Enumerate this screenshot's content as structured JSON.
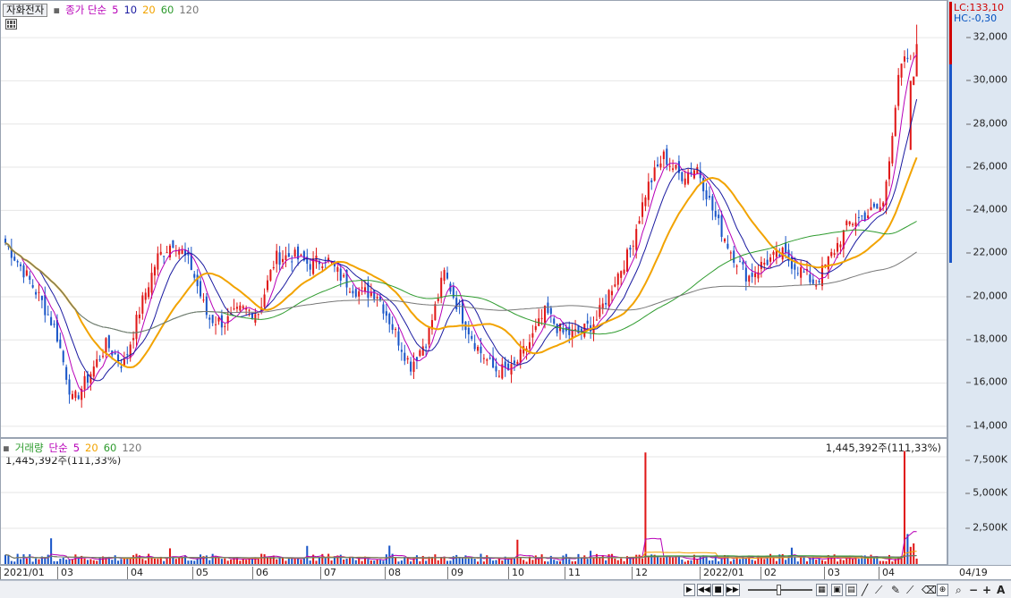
{
  "price_legend": {
    "symbol": "자화전자",
    "ma_label": "종가 단순",
    "periods": [
      "5",
      "10",
      "20",
      "60",
      "120"
    ],
    "colors": [
      "#b800b8",
      "#1a1aa0",
      "#f2a300",
      "#2e9b2e",
      "#777777"
    ]
  },
  "volume_legend": {
    "label": "거래량",
    "ma_label": "단순",
    "periods": [
      "5",
      "20",
      "60",
      "120"
    ],
    "colors": [
      "#b800b8",
      "#f2a300",
      "#2e9b2e",
      "#777777"
    ],
    "current_value": "1,445,392주(111,33%)",
    "current_value_right": "1,445,392주(111,33%)"
  },
  "limits": {
    "lc": "LC:133,10",
    "hc": "HC:-0,30",
    "lc_color": "#d00000",
    "hc_color": "#0050c0"
  },
  "price_axis_labels": [
    "32,000",
    "30,000",
    "28,000",
    "26,000",
    "24,000",
    "22,000",
    "20,000",
    "18,000",
    "16,000",
    "14,000"
  ],
  "volume_axis_labels": [
    "7,500K",
    "5,000K",
    "2,500K"
  ],
  "x_axis_labels": [
    "2021/01",
    "03",
    "04",
    "05",
    "06",
    "07",
    "08",
    "09",
    "10",
    "11",
    "12",
    "2022/01",
    "02",
    "03",
    "04",
    "04/19"
  ],
  "colors": {
    "up": "#e01818",
    "down": "#1a56c8",
    "grid": "#e6e6e6",
    "axis_bg": "#dde7f2"
  },
  "chart_data": [
    {
      "type": "candlestick",
      "title": "자화전자",
      "y_axis_ticks": [
        14000,
        16000,
        18000,
        20000,
        22000,
        24000,
        26000,
        28000,
        30000,
        32000
      ],
      "ylim": [
        13500,
        33700
      ],
      "x_ticks": [
        "2021/01",
        "03",
        "04",
        "05",
        "06",
        "07",
        "08",
        "09",
        "10",
        "11",
        "12",
        "2022/01",
        "02",
        "03",
        "04"
      ],
      "close_path": [
        {
          "d": "2021/01",
          "v": 22500
        },
        {
          "d": "",
          "v": 21300
        },
        {
          "d": "",
          "v": 20000
        },
        {
          "d": "",
          "v": 18400
        },
        {
          "d": "03",
          "v": 15100
        },
        {
          "d": "",
          "v": 16400
        },
        {
          "d": "",
          "v": 17800
        },
        {
          "d": "",
          "v": 16800
        },
        {
          "d": "04",
          "v": 19500
        },
        {
          "d": "",
          "v": 21800
        },
        {
          "d": "",
          "v": 22600
        },
        {
          "d": "",
          "v": 21400
        },
        {
          "d": "05",
          "v": 19000
        },
        {
          "d": "",
          "v": 18800
        },
        {
          "d": "",
          "v": 19400
        },
        {
          "d": "06",
          "v": 19300
        },
        {
          "d": "",
          "v": 21800
        },
        {
          "d": "",
          "v": 21900
        },
        {
          "d": "07",
          "v": 21500
        },
        {
          "d": "",
          "v": 21800
        },
        {
          "d": "",
          "v": 20800
        },
        {
          "d": "08",
          "v": 20200
        },
        {
          "d": "",
          "v": 20200
        },
        {
          "d": "",
          "v": 18500
        },
        {
          "d": "",
          "v": 16800
        },
        {
          "d": "09",
          "v": 18100
        },
        {
          "d": "",
          "v": 21100
        },
        {
          "d": "",
          "v": 19200
        },
        {
          "d": "",
          "v": 17600
        },
        {
          "d": "10",
          "v": 16600
        },
        {
          "d": "",
          "v": 16600
        },
        {
          "d": "",
          "v": 17800
        },
        {
          "d": "11",
          "v": 19300
        },
        {
          "d": "",
          "v": 18300
        },
        {
          "d": "",
          "v": 18300
        },
        {
          "d": "",
          "v": 18900
        },
        {
          "d": "",
          "v": 20600
        },
        {
          "d": "12",
          "v": 22100
        },
        {
          "d": "",
          "v": 25000
        },
        {
          "d": "",
          "v": 26500
        },
        {
          "d": "",
          "v": 25600
        },
        {
          "d": "2022/01",
          "v": 26000
        },
        {
          "d": "",
          "v": 23800
        },
        {
          "d": "",
          "v": 22100
        },
        {
          "d": "02",
          "v": 20900
        },
        {
          "d": "",
          "v": 21600
        },
        {
          "d": "",
          "v": 22000
        },
        {
          "d": "",
          "v": 21300
        },
        {
          "d": "03",
          "v": 20600
        },
        {
          "d": "",
          "v": 22000
        },
        {
          "d": "",
          "v": 23400
        },
        {
          "d": "",
          "v": 23800
        },
        {
          "d": "04",
          "v": 24200
        },
        {
          "d": "",
          "v": 30500
        },
        {
          "d": "",
          "v": 31700
        }
      ],
      "moving_average_periods": [
        5,
        10,
        20,
        60,
        120
      ]
    },
    {
      "type": "bar",
      "title": "거래량",
      "y_axis_ticks": [
        "2,500K",
        "5,000K",
        "7,500K"
      ],
      "ylim": [
        0,
        8500
      ],
      "unit": "K",
      "spikes": [
        {
          "x": "12",
          "value": 7800
        },
        {
          "x": "04",
          "value": 7900
        },
        {
          "x": "04",
          "value": 2100
        }
      ],
      "baseline_typical": 400,
      "last_value": 1445392,
      "last_ratio_percent": 111.33
    }
  ]
}
